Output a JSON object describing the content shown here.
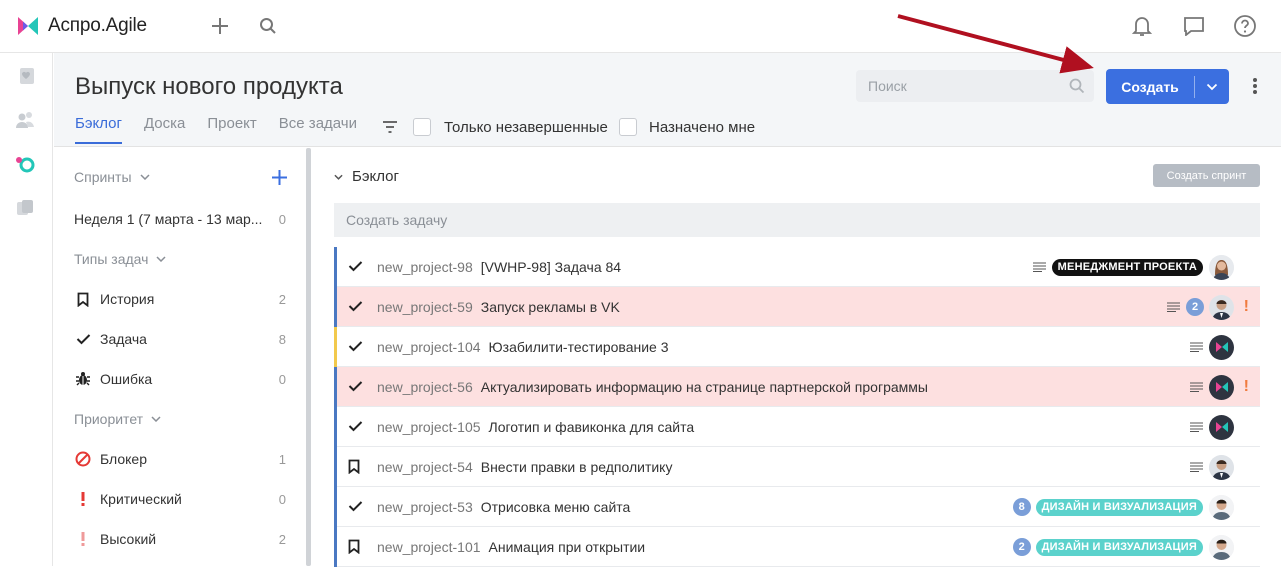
{
  "app": {
    "name": "Аспро.Agile"
  },
  "header": {
    "title": "Выпуск нового продукта",
    "tabs": [
      "Бэклог",
      "Доска",
      "Проект",
      "Все задачи"
    ],
    "filter_unfinished": "Только незавершенные",
    "filter_assigned": "Назначено мне",
    "search_placeholder": "Поиск",
    "create_label": "Создать"
  },
  "sidebar": {
    "sprints_label": "Спринты",
    "sprint_item": {
      "label": "Неделя 1 (7 марта - 13 мар...",
      "count": "0"
    },
    "types_label": "Типы задач",
    "types": [
      {
        "label": "История",
        "count": "2",
        "icon": "bookmark-icon"
      },
      {
        "label": "Задача",
        "count": "8",
        "icon": "check-icon"
      },
      {
        "label": "Ошибка",
        "count": "0",
        "icon": "bug-icon"
      }
    ],
    "priority_label": "Приоритет",
    "priorities": [
      {
        "label": "Блокер",
        "count": "1",
        "icon": "blocker-icon",
        "color": "#e53935"
      },
      {
        "label": "Критический",
        "count": "0",
        "icon": "critical-icon",
        "color": "#e53935"
      },
      {
        "label": "Высокий",
        "count": "2",
        "icon": "high-icon",
        "color": "#ef9a9a"
      }
    ]
  },
  "backlog": {
    "title": "Бэклог",
    "create_sprint_label": "Создать спринт",
    "new_task_placeholder": "Создать задачу",
    "tasks": [
      {
        "key": "new_project-98",
        "title": "[VWHP-98] Задача 84",
        "type": "check",
        "bar_color": "#4a78c2",
        "highlight": false,
        "tag": "МЕНЕДЖМЕНТ ПРОЕКТА",
        "tag_style": "dark",
        "count": "",
        "avatar": "woman",
        "urgent": false
      },
      {
        "key": "new_project-59",
        "title": "Запуск рекламы в VK",
        "type": "check",
        "bar_color": "#4a78c2",
        "highlight": true,
        "tag": "",
        "tag_style": "",
        "count": "2",
        "avatar": "man",
        "urgent": true
      },
      {
        "key": "new_project-104",
        "title": "Юзабилити-тестирование 3",
        "type": "check",
        "bar_color": "#f2c94c",
        "highlight": false,
        "tag": "",
        "tag_style": "",
        "count": "",
        "avatar": "logo",
        "urgent": false
      },
      {
        "key": "new_project-56",
        "title": "Актуализировать информацию на странице партнерской программы",
        "type": "check",
        "bar_color": "#4a78c2",
        "highlight": true,
        "tag": "",
        "tag_style": "",
        "count": "",
        "avatar": "logo",
        "urgent": true
      },
      {
        "key": "new_project-105",
        "title": "Логотип и фавиконка для сайта",
        "type": "check",
        "bar_color": "#4a78c2",
        "highlight": false,
        "tag": "",
        "tag_style": "",
        "count": "",
        "avatar": "logo",
        "urgent": false
      },
      {
        "key": "new_project-54",
        "title": "Внести правки в редполитику",
        "type": "bookmark",
        "bar_color": "#4a78c2",
        "highlight": false,
        "tag": "",
        "tag_style": "",
        "count": "",
        "avatar": "man",
        "urgent": false
      },
      {
        "key": "new_project-53",
        "title": "Отрисовка меню сайта",
        "type": "check",
        "bar_color": "#4a78c2",
        "highlight": false,
        "tag": "ДИЗАЙН И ВИЗУАЛИЗАЦИЯ",
        "tag_style": "teal",
        "count": "8",
        "avatar": "man2",
        "urgent": false
      },
      {
        "key": "new_project-101",
        "title": "Анимация при открытии",
        "type": "bookmark",
        "bar_color": "#4a78c2",
        "highlight": false,
        "tag": "ДИЗАЙН И ВИЗУАЛИЗАЦИЯ",
        "tag_style": "teal",
        "count": "2",
        "avatar": "man2",
        "urgent": false
      }
    ]
  }
}
